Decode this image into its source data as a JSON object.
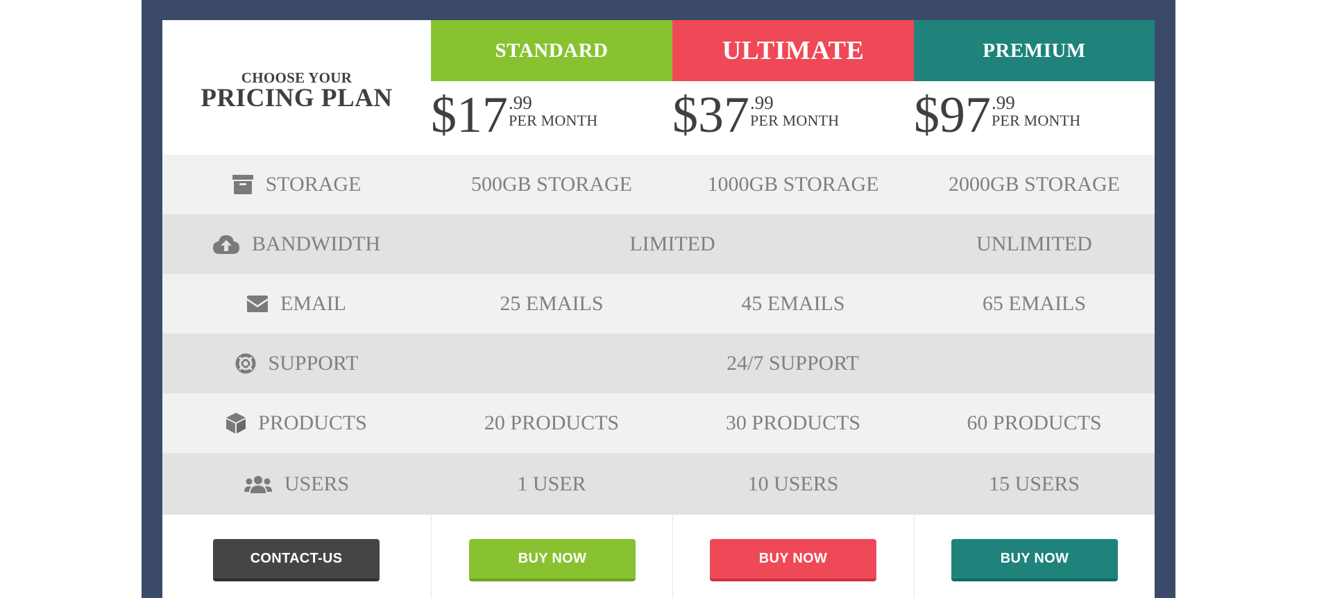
{
  "heading": {
    "small": "CHOOSE YOUR",
    "big": "PRICING PLAN"
  },
  "colors": {
    "frame": "#3a4a68",
    "standard": "#89c231",
    "ultimate": "#ef4957",
    "premium": "#1f837c",
    "contact": "#454545"
  },
  "plans": [
    {
      "name": "STANDARD",
      "price": "$17",
      "cents": ".99",
      "period": "PER MONTH",
      "button": "BUY NOW"
    },
    {
      "name": "ULTIMATE",
      "price": "$37",
      "cents": ".99",
      "period": "PER MONTH",
      "button": "BUY NOW"
    },
    {
      "name": "PREMIUM",
      "price": "$97",
      "cents": ".99",
      "period": "PER MONTH",
      "button": "BUY NOW"
    }
  ],
  "features": {
    "storage": {
      "icon": "archive-box-icon",
      "label": "STORAGE",
      "values": [
        "500GB STORAGE",
        "1000GB STORAGE",
        "2000GB STORAGE"
      ]
    },
    "bandwidth": {
      "icon": "cloud-upload-icon",
      "label": "BANDWIDTH",
      "values": [
        "LIMITED",
        "UNLIMITED"
      ]
    },
    "email": {
      "icon": "envelope-icon",
      "label": "EMAIL",
      "values": [
        "25 EMAILS",
        "45 EMAILS",
        "65 EMAILS"
      ]
    },
    "support": {
      "icon": "life-ring-icon",
      "label": "SUPPORT",
      "values": [
        "24/7 SUPPORT"
      ]
    },
    "products": {
      "icon": "cube-icon",
      "label": "PRODUCTS",
      "values": [
        "20 PRODUCTS",
        "30 PRODUCTS",
        "60 PRODUCTS"
      ]
    },
    "users": {
      "icon": "users-icon",
      "label": "USERS",
      "values": [
        "1 USER",
        "10 USERS",
        "15 USERS"
      ]
    }
  },
  "contact_button": "CONTACT-US"
}
